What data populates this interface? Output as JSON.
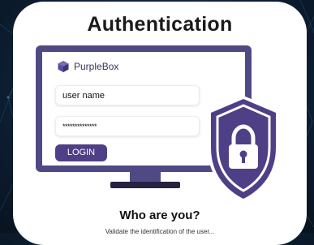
{
  "title": "Authentication",
  "brand": {
    "name": "PurpleBox"
  },
  "login_form": {
    "username_value": "user name",
    "password_value": "**************",
    "login_label": "LOGIN"
  },
  "heading": "Who are you?",
  "description": "Validate the identification of the user...",
  "colors": {
    "background": "#0f2238",
    "card": "#ffffff",
    "accent": "#4f3f86",
    "monitor": "#4f4a84"
  },
  "icons": [
    "purplebox-logo-icon",
    "shield-lock-icon"
  ]
}
